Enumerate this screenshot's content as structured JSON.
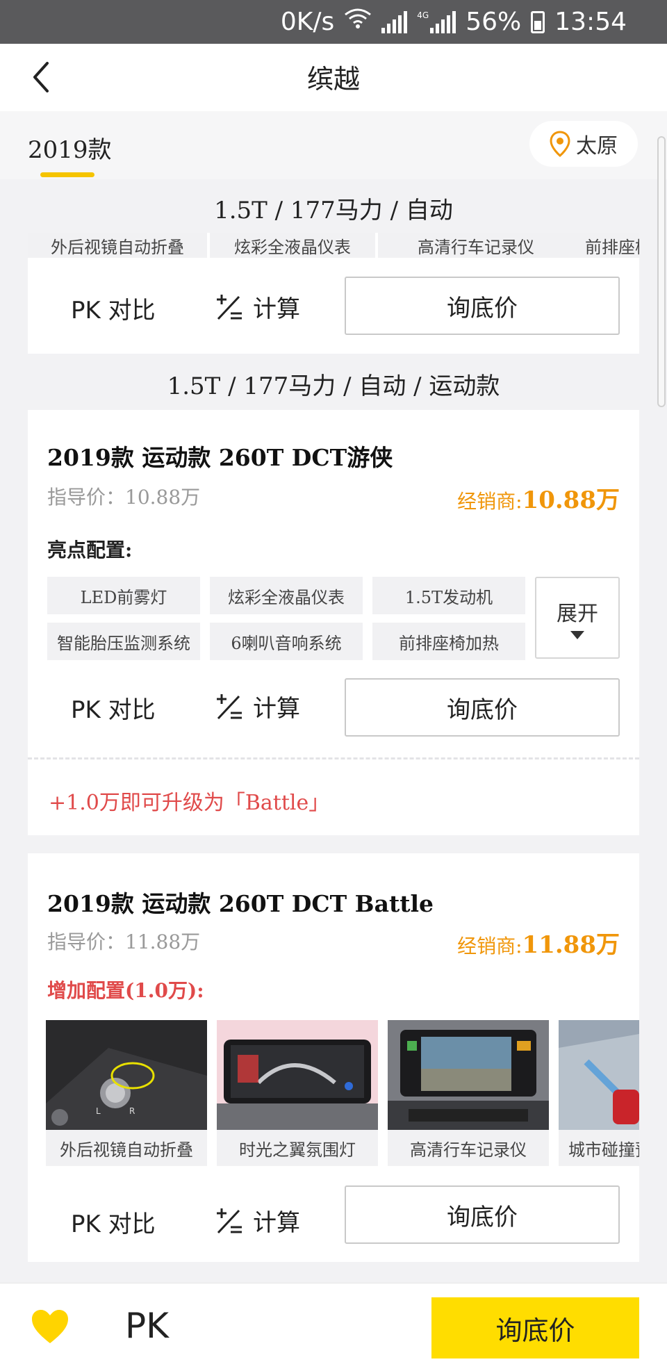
{
  "status_bar": {
    "net_speed": "0K/s",
    "net_4g": "4G",
    "battery": "56%",
    "time": "13:54"
  },
  "header": {
    "title": "缤越"
  },
  "year_tab": {
    "label": "2019款"
  },
  "city": {
    "name": "太原"
  },
  "section1": {
    "title": "1.5T / 177马力 / 自动",
    "chips": [
      "外后视镜自动折叠",
      "炫彩全液晶仪表",
      "高清行车记录仪",
      "前排座椅加热"
    ],
    "pk_label": "PK 对比",
    "calc_label": "计算",
    "inquiry_label": "询底价"
  },
  "section2": {
    "title": "1.5T / 177马力 / 自动 / 运动款"
  },
  "card2": {
    "model_name": "2019款 运动款 260T DCT游侠",
    "guide_price": "指导价：10.88万",
    "dealer_label": "经销商:",
    "dealer_price": "10.88万",
    "highlight_title": "亮点配置:",
    "chips": [
      "LED前雾灯",
      "炫彩全液晶仪表",
      "1.5T发动机",
      "智能胎压监测系统",
      "6喇叭音响系统",
      "前排座椅加热"
    ],
    "expand_label": "展开",
    "pk_label": "PK 对比",
    "calc_label": "计算",
    "inquiry_label": "询底价",
    "upgrade_text": "+1.0万即可升级为「Battle」"
  },
  "card3": {
    "model_name": "2019款 运动款 260T DCT Battle",
    "guide_price": "指导价：11.88万",
    "dealer_label": "经销商:",
    "dealer_price": "11.88万",
    "added_title": "增加配置(1.0万):",
    "features": [
      "外后视镜自动折叠",
      "时光之翼氛围灯",
      "高清行车记录仪",
      "城市碰撞预警"
    ],
    "pk_label": "PK 对比",
    "calc_label": "计算",
    "inquiry_label": "询底价"
  },
  "bottom_bar": {
    "pk_label": "PK",
    "inquiry_label": "询底价"
  },
  "colors": {
    "accent_yellow": "#ffdd00",
    "dealer_orange": "#f0960a",
    "upgrade_red": "#e04a4a",
    "heart": "#ffd400"
  }
}
